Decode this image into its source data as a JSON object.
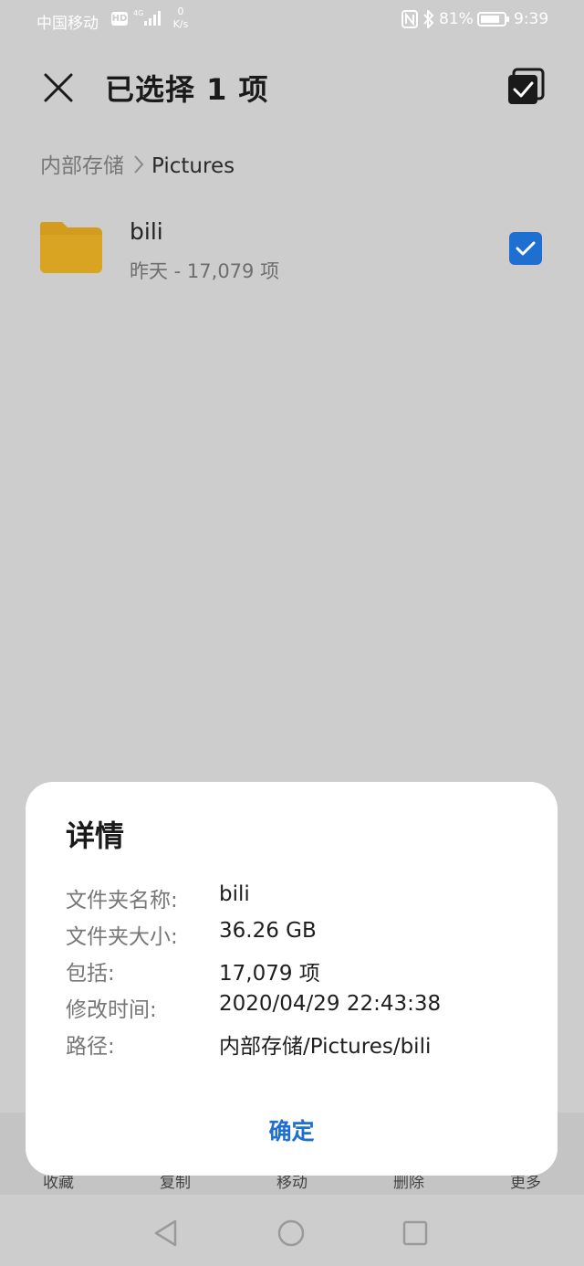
{
  "status_bar": {
    "carrier": "中国移动",
    "hd_badge": "HD",
    "network": "4G",
    "speed_value": "0",
    "speed_unit": "K/s",
    "battery_percent": "81%",
    "time": "9:39"
  },
  "header": {
    "title": "已选择 1 项"
  },
  "breadcrumb": {
    "root": "内部存储",
    "current": "Pictures"
  },
  "file": {
    "name": "bili",
    "meta": "昨天 - 17,079 项",
    "checked": true
  },
  "toolbar": {
    "items": [
      "收藏",
      "复制",
      "移动",
      "删除",
      "更多"
    ]
  },
  "dialog": {
    "title": "详情",
    "rows": [
      {
        "label": "文件夹名称:",
        "value": "bili"
      },
      {
        "label": "文件夹大小:",
        "value": "36.26 GB"
      },
      {
        "label": "包括:",
        "value": "17,079 项"
      },
      {
        "label": "修改时间:",
        "value": "2020/04/29 22:43:38"
      },
      {
        "label": "路径:",
        "value": "内部存储/Pictures/bili"
      }
    ],
    "ok_label": "确定"
  },
  "colors": {
    "accent": "#1f6fd1",
    "folder": "#d39c1f",
    "scrim_background": "#cdcdcd"
  }
}
